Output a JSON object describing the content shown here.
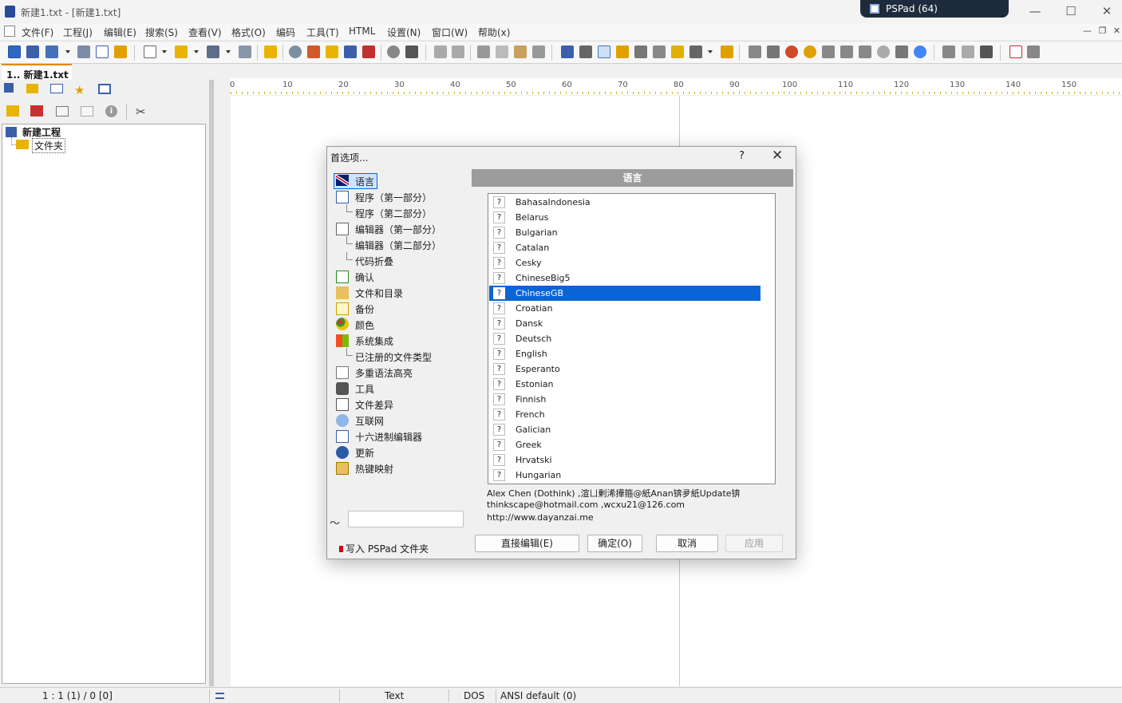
{
  "window": {
    "title": "新建1.txt - [新建1.txt]",
    "taskbar_label": "PSPad (64)"
  },
  "menu": [
    "文件(F)",
    "工程(J)",
    "编辑(E)",
    "搜索(S)",
    "查看(V)",
    "格式(O)",
    "编码",
    "工具(T)",
    "HTML",
    "设置(N)",
    "窗口(W)",
    "帮助(x)"
  ],
  "left_panel": {
    "tab_label": "1.. 新建1.txt",
    "tree": {
      "project": "新建工程",
      "folder": "文件夹"
    }
  },
  "ruler": [
    "0",
    "10",
    "20",
    "30",
    "40",
    "50",
    "60",
    "70",
    "80",
    "90",
    "100",
    "110",
    "120",
    "130",
    "140",
    "150"
  ],
  "status": {
    "position": "1 : 1 (1) / 0  [0]",
    "mode": "Text",
    "line_ending": "DOS",
    "encoding": "ANSI default (0)"
  },
  "dialog": {
    "title": "首选项...",
    "help": "?",
    "close": "✕",
    "section": "语言",
    "nav": [
      {
        "label": "语言",
        "icon": "uk-flag-icon"
      },
      {
        "label": "程序（第一部分）",
        "icon": "program-window-icon"
      },
      {
        "label": "程序（第二部分）",
        "icon": ""
      },
      {
        "label": "编辑器（第一部分）",
        "icon": "editor-pencil-icon"
      },
      {
        "label": "编辑器（第二部分）",
        "icon": ""
      },
      {
        "label": "代码折叠",
        "icon": ""
      },
      {
        "label": "确认",
        "icon": "confirm-check-icon"
      },
      {
        "label": "文件和目录",
        "icon": "folder-files-icon"
      },
      {
        "label": "备份",
        "icon": "backup-disk-icon"
      },
      {
        "label": "颜色",
        "icon": "palette-icon"
      },
      {
        "label": "系统集成",
        "icon": "windows-logo-icon"
      },
      {
        "label": "已注册的文件类型",
        "icon": ""
      },
      {
        "label": "多重语法高亮",
        "icon": "multi-syntax-icon"
      },
      {
        "label": "工具",
        "icon": "gear-icon"
      },
      {
        "label": "文件差异",
        "icon": "file-diff-icon"
      },
      {
        "label": "互联网",
        "icon": "globe-icon"
      },
      {
        "label": "十六进制编辑器",
        "icon": "hex-editor-icon"
      },
      {
        "label": "更新",
        "icon": "update-arrow-icon"
      },
      {
        "label": "热键映射",
        "icon": "keyboard-icon"
      }
    ],
    "languages": [
      {
        "label": "BahasaIndonesia",
        "flag": "?"
      },
      {
        "label": "Belarus",
        "flag": "?"
      },
      {
        "label": "Bulgarian",
        "flag": "?"
      },
      {
        "label": "Catalan",
        "flag": "?"
      },
      {
        "label": "Cesky",
        "flag": "?"
      },
      {
        "label": "ChineseBig5",
        "flag": "?"
      },
      {
        "label": "ChineseGB",
        "flag": "?"
      },
      {
        "label": "Croatian",
        "flag": "?"
      },
      {
        "label": "Dansk",
        "flag": "?"
      },
      {
        "label": "Deutsch",
        "flag": "?"
      },
      {
        "label": "English",
        "flag": "?"
      },
      {
        "label": "Esperanto",
        "flag": "?"
      },
      {
        "label": "Estonian",
        "flag": "?"
      },
      {
        "label": "Finnish",
        "flag": "?"
      },
      {
        "label": "French",
        "flag": "?"
      },
      {
        "label": "Galician",
        "flag": "?"
      },
      {
        "label": "Greek",
        "flag": "?"
      },
      {
        "label": "Hrvatski",
        "flag": "?"
      },
      {
        "label": "Hungarian",
        "flag": "?"
      }
    ],
    "selected_language": "ChineseGB",
    "credits": [
      "Alex Chen (Dothink) ,渲ㄩ剰浠撶箍@紙Anan锛夛紙Update锛",
      "thinkscape@hotmail.com ,wcxu21@126.com",
      "http://www.dayanzai.me"
    ],
    "write_folder_label": "写入 PSPad 文件夹",
    "search_value": "",
    "buttons": {
      "direct_edit": "直接编辑(E)",
      "ok": "确定(O)",
      "cancel": "取消",
      "apply": "应用"
    }
  },
  "colors": {
    "accent": "#0a64d6",
    "tab_accent": "#e08b00",
    "section_header": "#9c9c9c",
    "taskbar_pill": "#1e2b3c"
  }
}
